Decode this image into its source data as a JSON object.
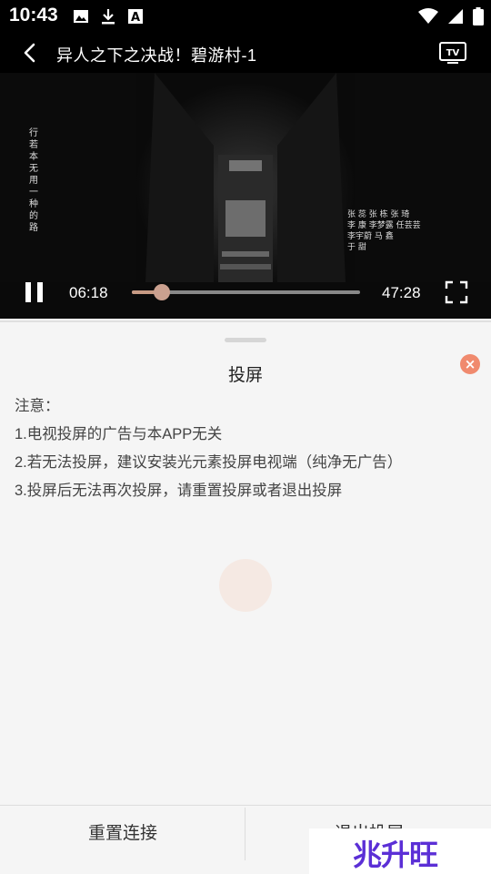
{
  "status_bar": {
    "time": "10:43",
    "icons": [
      "image-icon",
      "download-icon",
      "a-icon",
      "wifi-icon",
      "signal-icon",
      "battery-icon"
    ]
  },
  "header": {
    "title": "异人之下之决战！碧游村-1",
    "back_icon": "back-arrow-icon",
    "cast_icon": "tv-cast-icon"
  },
  "player": {
    "current_time": "06:18",
    "total_time": "47:28",
    "progress": 0.133,
    "state": "playing",
    "credits_left": "行 若 本 无 用 一 种 的 路",
    "credits_right": [
      "张 蕊  张 栋  张 琦",
      "李 康  李梦露  任芸芸",
      "李宇蔚  马 鑫",
      "于 甜"
    ]
  },
  "sheet": {
    "title": "投屏",
    "notes": [
      "注意：",
      "1.电视投屏的广告与本APP无关",
      "2.若无法投屏，建议安装光元素投屏电视端（纯净无广告）",
      "3.投屏后无法再次投屏，请重置投屏或者退出投屏"
    ]
  },
  "buttons": {
    "reset": "重置连接",
    "exit": "退出投屏"
  },
  "watermark": "兆升旺",
  "colors": {
    "accent": "#c79a84",
    "close_button": "#f08a6e",
    "watermark": "#5b2fd6"
  }
}
